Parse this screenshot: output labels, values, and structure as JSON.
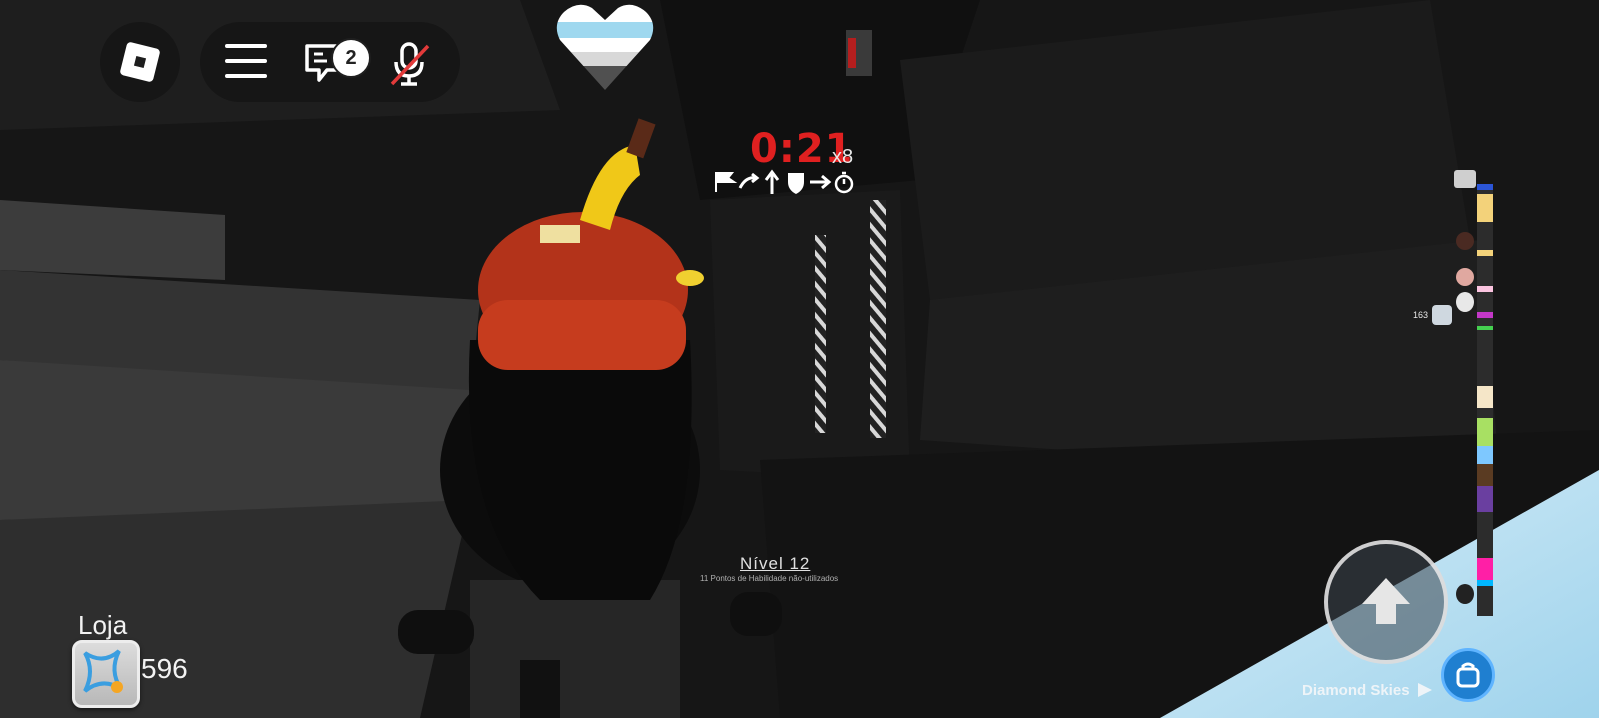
{
  "hud": {
    "chat_badge_count": "2",
    "icons": [
      "roblox-logo-icon",
      "menu-icon",
      "chat-icon",
      "mic-muted-icon",
      "heart-icon"
    ]
  },
  "run": {
    "timer": "0:21",
    "multiplier": "x8",
    "modifier_icons": [
      "flag-icon",
      "swap-icon",
      "arrow-up-icon",
      "shield-icon",
      "arrow-right-icon",
      "stopwatch-icon"
    ]
  },
  "level": {
    "title": "Nível 12",
    "subtitle": "11 Pontos de Habilidade não-utilizados"
  },
  "shop": {
    "label": "Loja",
    "coins": "596"
  },
  "leaderboard": {
    "player_score": "163"
  },
  "area": {
    "name": "Diamond Skies"
  },
  "colors": {
    "timer": "#e02020",
    "heart_stripes": [
      "#ffffff",
      "#9fd8ef",
      "#d8d8d8",
      "#505050"
    ],
    "leaderboard_segments": [
      "#2b55d6",
      "#f3d27a",
      "#fbc4e0",
      "#c438c8",
      "#45d050",
      "#f5e6c8",
      "#a8e063",
      "#7ec8ff",
      "#5a3b22",
      "#6a3fa0",
      "#ff1fa6",
      "#00b7ff"
    ]
  }
}
